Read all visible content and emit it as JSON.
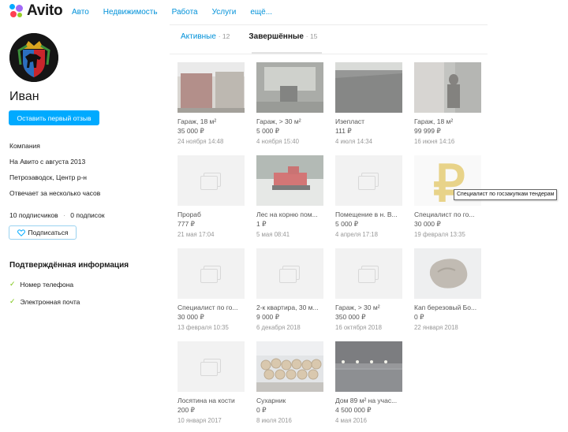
{
  "header": {
    "logo_text": "Avito",
    "nav": [
      "Авто",
      "Недвижимость",
      "Работа",
      "Услуги",
      "ещё..."
    ]
  },
  "profile": {
    "name": "Иван",
    "review_button": "Оставить первый отзыв",
    "type": "Компания",
    "since": "На Авито с августа 2013",
    "location": "Петрозаводск, Центр р-н",
    "response": "Отвечает за несколько часов",
    "subscribers": "10 подписчиков",
    "subscriptions": "0 подписок",
    "subscribe_button": "Подписаться"
  },
  "verified": {
    "title": "Подтверждённая информация",
    "items": [
      "Номер телефона",
      "Электронная почта"
    ]
  },
  "tabs": {
    "active_label": "Активные",
    "active_count": "12",
    "done_label": "Завершённые",
    "done_count": "15"
  },
  "tooltip": "Специалист по госзакупкам тендерам",
  "items": [
    {
      "title": "Гараж, 18 м²",
      "price": "35 000 ₽",
      "date": "24 ноября 14:48",
      "image": "garage-photo"
    },
    {
      "title": "Гараж, > 30 м²",
      "price": "5 000 ₽",
      "date": "4 ноября 15:40",
      "image": "garage-interior-photo"
    },
    {
      "title": "Изепласт",
      "price": "111 ₽",
      "date": "4 июля 14:34",
      "image": "roofing-photo"
    },
    {
      "title": "Гараж, 18 м²",
      "price": "99 999 ₽",
      "date": "16 июня 14:16",
      "image": "garage-man-photo"
    },
    {
      "title": "Прораб",
      "price": "777 ₽",
      "date": "21 мая 17:04",
      "image": "placeholder"
    },
    {
      "title": "Лес на корню пом...",
      "price": "1 ₽",
      "date": "5 мая 08:41",
      "image": "forest-machine-photo"
    },
    {
      "title": "Помещение в н. В...",
      "price": "5 000 ₽",
      "date": "4 апреля 17:18",
      "image": "placeholder"
    },
    {
      "title": "Специалист по го...",
      "price": "30 000 ₽",
      "date": "19 февраля 13:35",
      "image": "ruble-sign-image"
    },
    {
      "title": "Специалист по го...",
      "price": "30 000 ₽",
      "date": "13 февраля 10:35",
      "image": "placeholder"
    },
    {
      "title": "2-к квартира, 30 м...",
      "price": "9 000 ₽",
      "date": "6 декабря 2018",
      "image": "placeholder"
    },
    {
      "title": "Гараж, > 30 м²",
      "price": "350 000 ₽",
      "date": "16 октября 2018",
      "image": "placeholder"
    },
    {
      "title": "Кап березовый Бо...",
      "price": "0 ₽",
      "date": "22 января 2018",
      "image": "burl-photo"
    },
    {
      "title": "Лосятина на кости",
      "price": "200 ₽",
      "date": "10 января 2017",
      "image": "placeholder"
    },
    {
      "title": "Сухарник",
      "price": "0 ₽",
      "date": "8 июля 2016",
      "image": "logs-photo"
    },
    {
      "title": "Дом 89 м² на учас...",
      "price": "4 500 000 ₽",
      "date": "4 мая 2016",
      "image": "house-night-photo"
    }
  ]
}
